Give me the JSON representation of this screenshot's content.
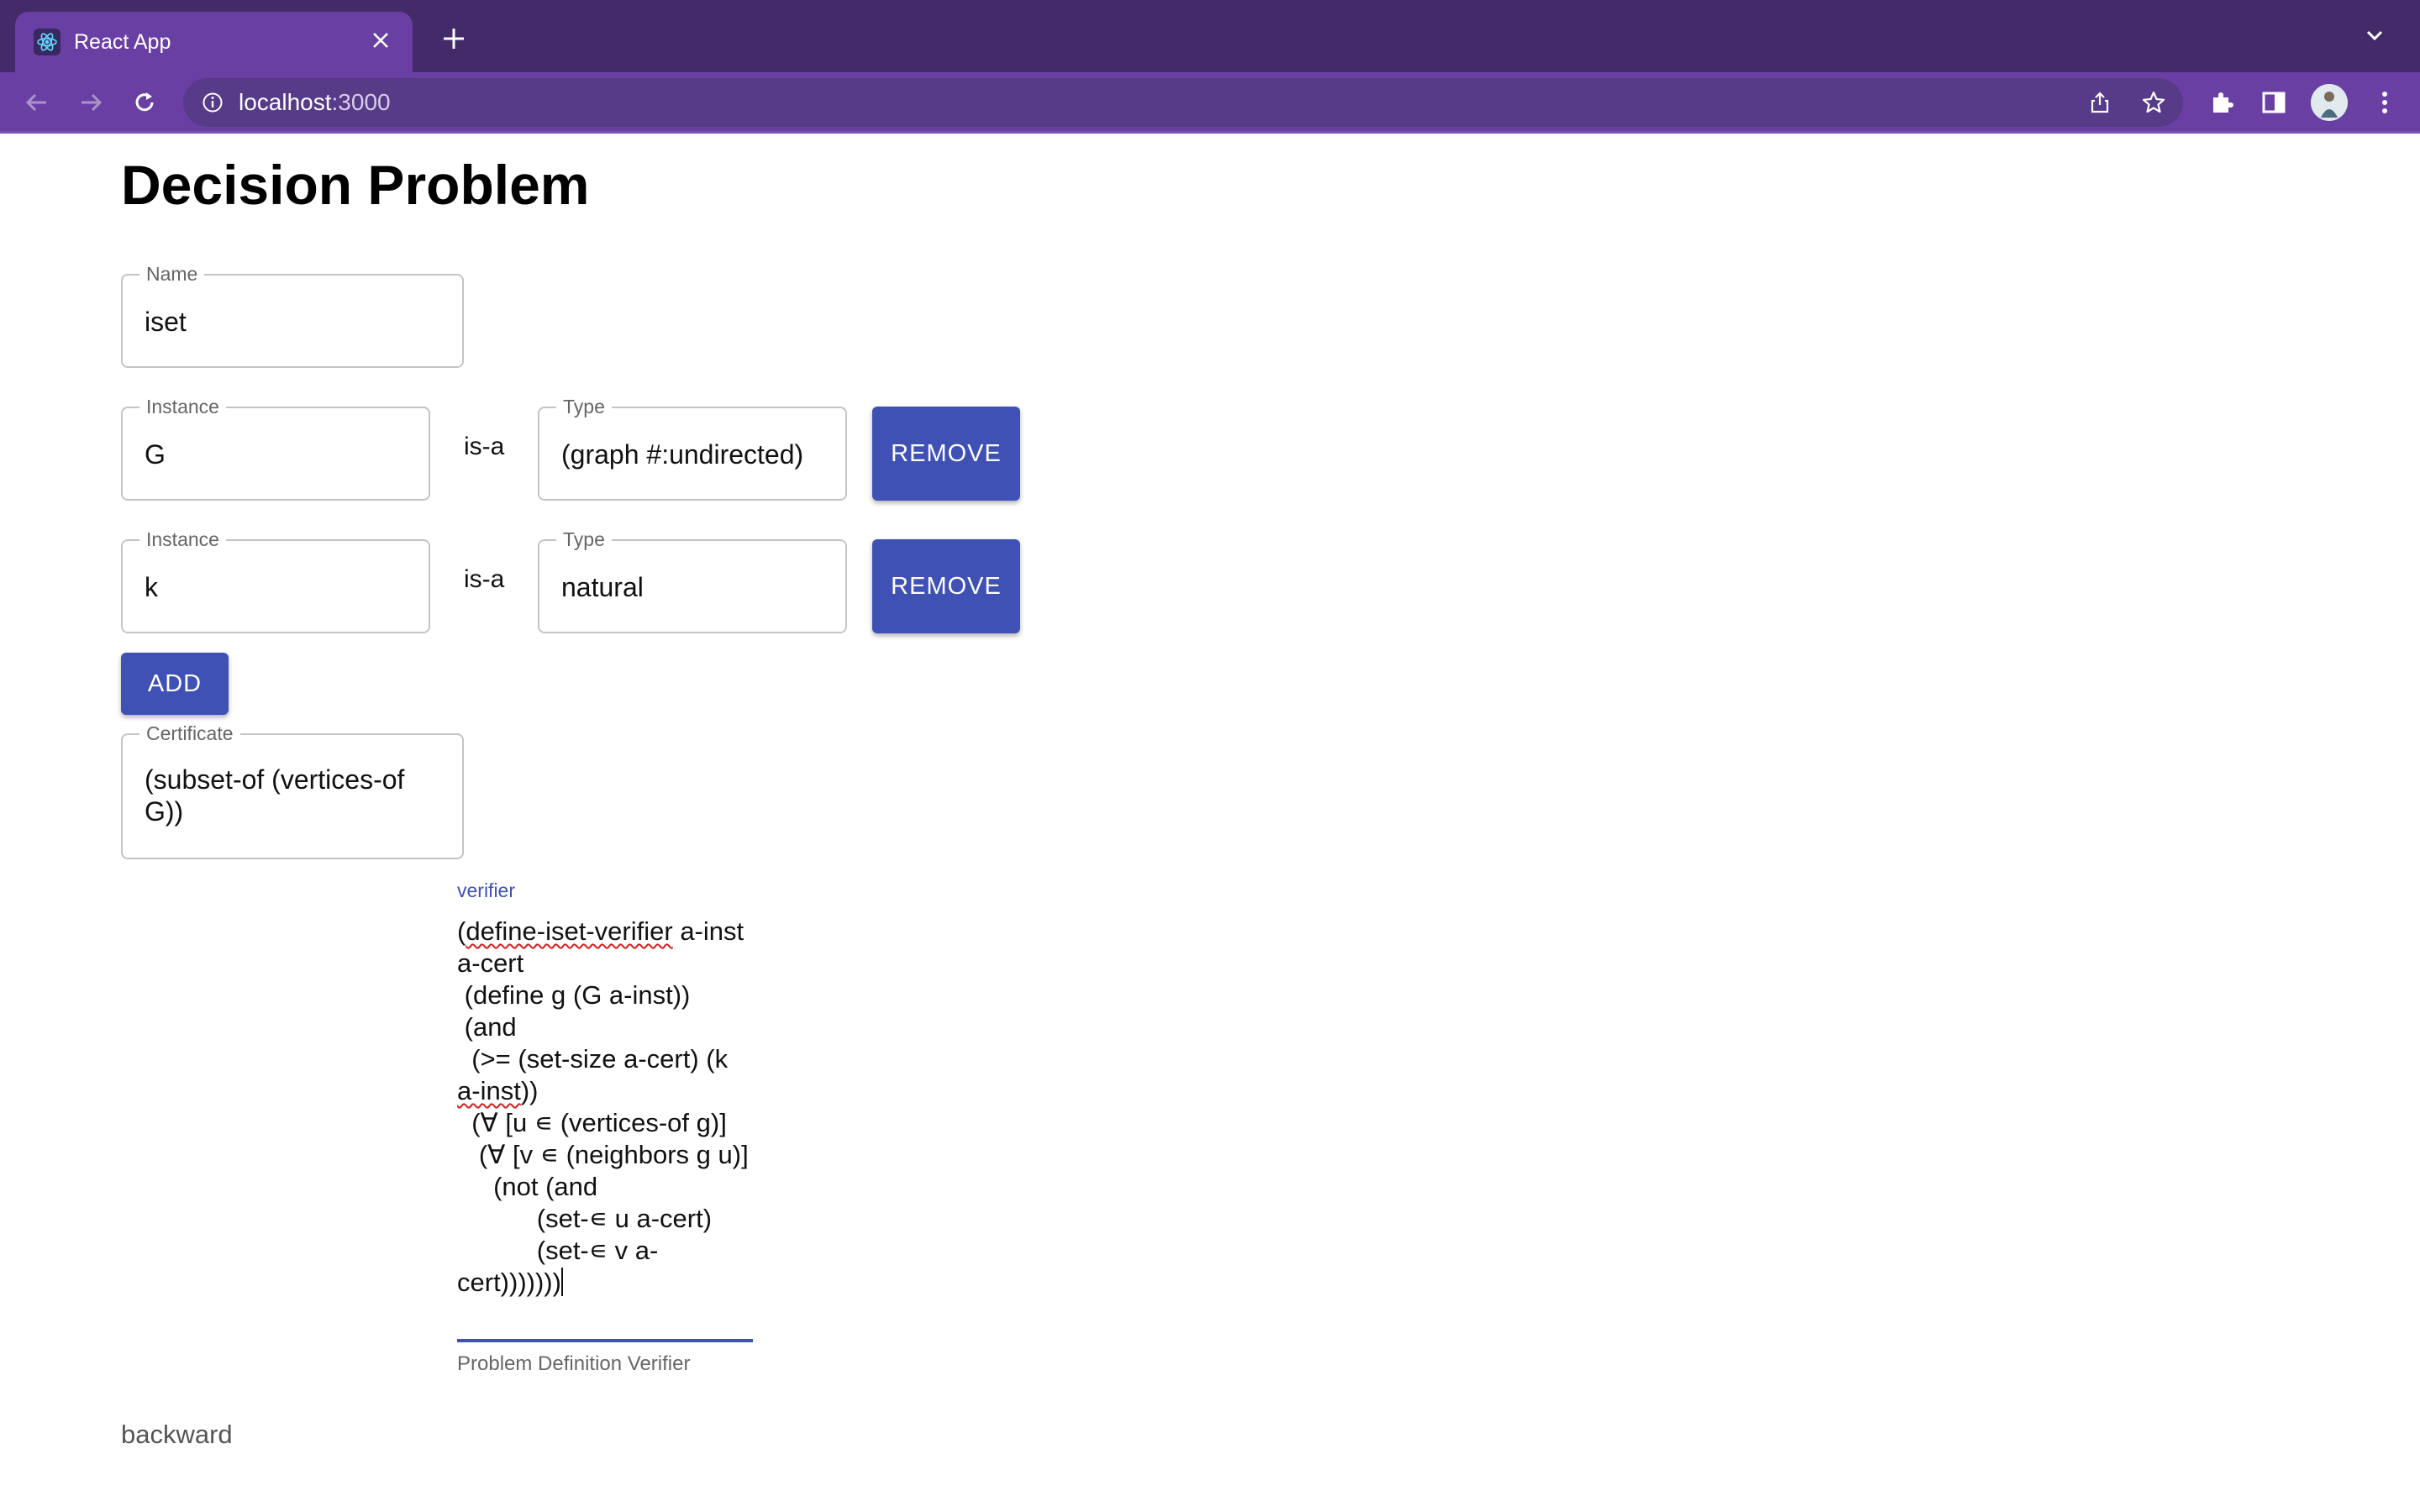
{
  "browser": {
    "tab_title": "React App",
    "url_host": "localhost",
    "url_port": ":3000",
    "theme_color": "#6a3fa4"
  },
  "page": {
    "title": "Decision Problem",
    "name_field": {
      "label": "Name",
      "value": "iset"
    },
    "instances": [
      {
        "instance_label": "Instance",
        "instance_value": "G",
        "relation": "is-a",
        "type_label": "Type",
        "type_value": "(graph #:undirected)",
        "remove_label": "REMOVE"
      },
      {
        "instance_label": "Instance",
        "instance_value": "k",
        "relation": "is-a",
        "type_label": "Type",
        "type_value": "natural",
        "remove_label": "REMOVE"
      }
    ],
    "add_label": "ADD",
    "certificate": {
      "label": "Certificate",
      "value": "(subset-of (vertices-of G))"
    },
    "verifier": {
      "label": "verifier",
      "lines": [
        "(define-iset-verifier a-inst a-cert",
        " (define g (G a-inst))",
        " (and",
        "  (>= (set-size a-cert) (k a-inst))",
        "  (∀ [u ∊ (vertices-of g)]",
        "   (∀ [v ∊ (neighbors g u)]",
        "     (not (and",
        "           (set-∊ u a-cert)",
        "           (set-∊ v a-cert)))))))"
      ],
      "helper": "Problem Definition Verifier"
    },
    "footer_link": "backward",
    "accent_color": "#3f51b5"
  }
}
